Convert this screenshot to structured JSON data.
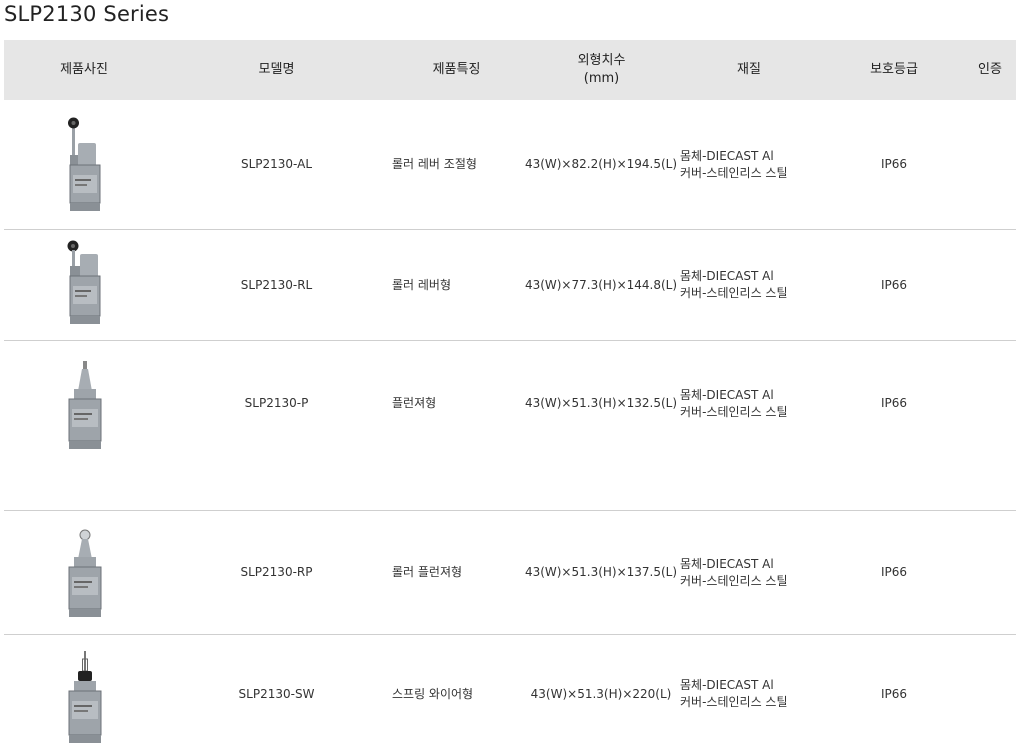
{
  "page": {
    "title": "SLP2130 Series"
  },
  "table": {
    "headers": {
      "photo": "제품사진",
      "model": "모델명",
      "feature": "제품특징",
      "dimension_line1": "외형치수",
      "dimension_line2": "(mm)",
      "material": "재질",
      "protection": "보호등급",
      "cert": "인증"
    },
    "rows": [
      {
        "model": "SLP2130-AL",
        "feature": "롤러 레버 조절형",
        "dimension": "43(W)×82.2(H)×194.5(L)",
        "material_body": "몸체-DIECAST Al",
        "material_cover": "커버-스테인리스 스틸",
        "protection": "IP66",
        "cert": "",
        "image": "adjustable-roller-lever-limit-switch"
      },
      {
        "model": "SLP2130-RL",
        "feature": "롤러 레버형",
        "dimension": "43(W)×77.3(H)×144.8(L)",
        "material_body": "몸체-DIECAST Al",
        "material_cover": "커버-스테인리스 스틸",
        "protection": "IP66",
        "cert": "",
        "image": "roller-lever-limit-switch"
      },
      {
        "model": "SLP2130-P",
        "feature": "플런져형",
        "dimension": "43(W)×51.3(H)×132.5(L)",
        "material_body": "몸체-DIECAST Al",
        "material_cover": "커버-스테인리스 스틸",
        "protection": "IP66",
        "cert": "",
        "image": "plunger-limit-switch"
      },
      {
        "model": "SLP2130-RP",
        "feature": "롤러 플런져형",
        "dimension": "43(W)×51.3(H)×137.5(L)",
        "material_body": "몸체-DIECAST Al",
        "material_cover": "커버-스테인리스 스틸",
        "protection": "IP66",
        "cert": "",
        "image": "roller-plunger-limit-switch"
      },
      {
        "model": "SLP2130-SW",
        "feature": "스프링 와이어형",
        "dimension": "43(W)×51.3(H)×220(L)",
        "material_body": "몸체-DIECAST Al",
        "material_cover": "커버-스테인리스 스틸",
        "protection": "IP66",
        "cert": "",
        "image": "spring-wire-limit-switch"
      }
    ]
  }
}
